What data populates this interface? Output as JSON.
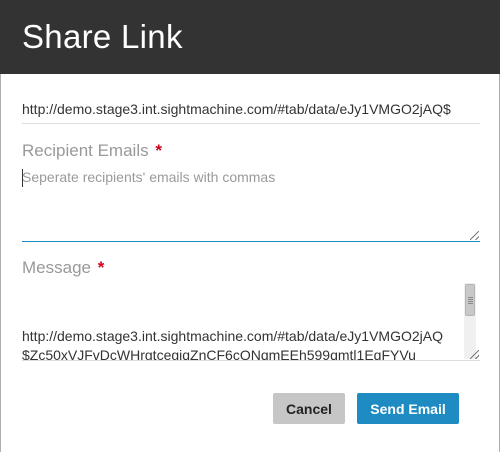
{
  "dialog": {
    "title": "Share Link"
  },
  "link": {
    "value": "http://demo.stage3.int.sightmachine.com/#tab/data/eJy1VMGO2jAQ$"
  },
  "recipients": {
    "label": "Recipient Emails",
    "required_mark": "*",
    "placeholder": "Seperate recipients' emails with commas"
  },
  "message": {
    "label": "Message",
    "required_mark": "*",
    "text": "http://demo.stage3.int.sightmachine.com/#tab/data/eJy1VMGO2jAQ$Zc50xVJFvDcWHrgtcegiqZnCF6cQNqmEEh599qmtl1EqFYVu"
  },
  "actions": {
    "cancel_label": "Cancel",
    "send_label": "Send Email"
  },
  "colors": {
    "header_bg": "#333333",
    "accent": "#1e8bc3",
    "required": "#d0021b",
    "cancel_bg": "#c6c6c6"
  }
}
